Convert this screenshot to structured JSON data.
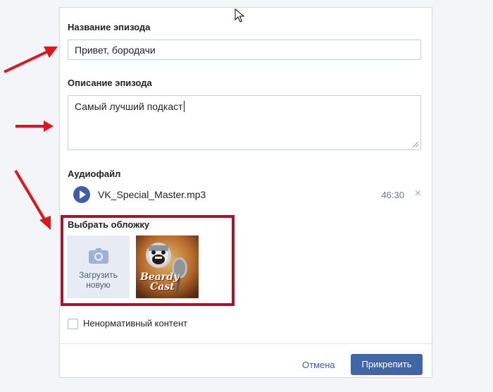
{
  "form": {
    "episode_title_label": "Название эпизода",
    "episode_title_value": "Привет, бородачи",
    "description_label": "Описание эпизода",
    "description_value": "Самый лучший подкаст",
    "audio_label": "Аудиофайл",
    "audio_file_name": "VK_Special_Master.mp3",
    "audio_duration": "46:30",
    "audio_remove_glyph": "×",
    "cover_label": "Выбрать обложку",
    "upload_label_line1": "Загрузить",
    "upload_label_line2": "новую",
    "cover_thumb_text_line1": "Beardy",
    "cover_thumb_text_line2": "Cast",
    "explicit_label": "Ненормативный контент",
    "explicit_checked": false
  },
  "footer": {
    "cancel_label": "Отмена",
    "attach_label": "Прикрепить"
  },
  "colors": {
    "accent": "#4166a8",
    "highlight_frame": "#a0172f",
    "annotation_arrow": "#e0161c"
  },
  "icons": {
    "play": "play-icon",
    "camera": "camera-icon",
    "close": "close-icon",
    "cursor": "mouse-cursor-icon"
  }
}
